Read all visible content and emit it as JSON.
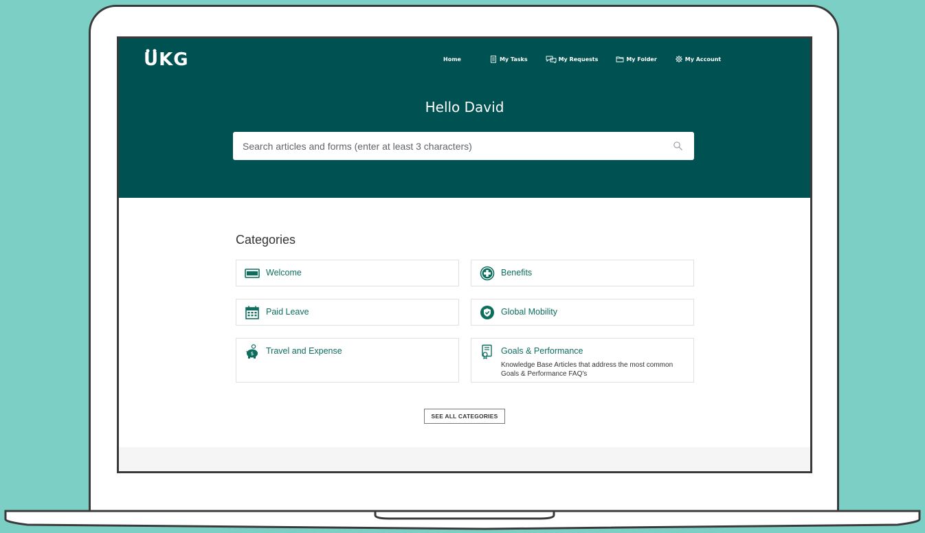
{
  "brand": {
    "logo_text": "UKG",
    "accent": "#005151",
    "link_color": "#0d6e5e"
  },
  "nav": {
    "items": [
      {
        "label": "Home",
        "icon": ""
      },
      {
        "label": "My Tasks",
        "icon": "clipboard-icon"
      },
      {
        "label": "My Requests",
        "icon": "chat-icon"
      },
      {
        "label": "My Folder",
        "icon": "folder-icon"
      },
      {
        "label": "My Account",
        "icon": "gear-icon"
      }
    ]
  },
  "hero": {
    "greeting": "Hello David",
    "search_placeholder": "Search articles and forms (enter at least 3 characters)"
  },
  "categories": {
    "title": "Categories",
    "items": [
      {
        "label": "Welcome",
        "icon": "card-icon",
        "description": ""
      },
      {
        "label": "Benefits",
        "icon": "medical-cross-icon",
        "description": ""
      },
      {
        "label": "Paid Leave",
        "icon": "calendar-icon",
        "description": ""
      },
      {
        "label": "Global Mobility",
        "icon": "shield-check-icon",
        "description": ""
      },
      {
        "label": "Travel and Expense",
        "icon": "piggy-bank-icon",
        "description": ""
      },
      {
        "label": "Goals & Performance",
        "icon": "certificate-icon",
        "description": "Knowledge Base Articles that address the most common Goals & Performance FAQ's"
      }
    ],
    "see_all_label": "SEE ALL CATEGORIES"
  }
}
